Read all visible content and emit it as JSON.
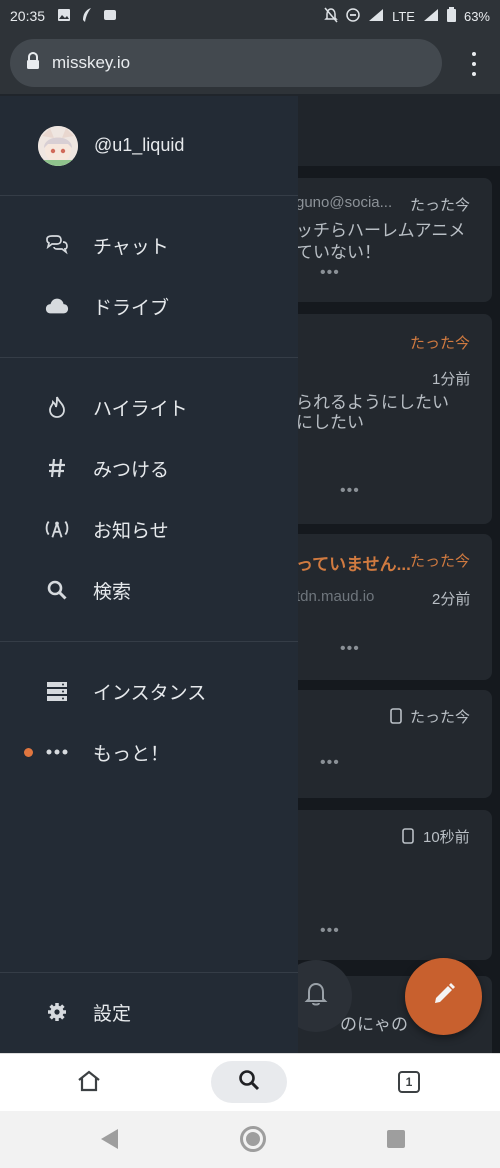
{
  "status_bar": {
    "time": "20:35",
    "network": "LTE",
    "battery": "63%",
    "icons_left": [
      "image-icon",
      "feather-icon",
      "app-icon"
    ],
    "icons_right": [
      "mute-icon",
      "dnd-icon",
      "signal-icon",
      "signal-icon",
      "battery-icon"
    ]
  },
  "browser": {
    "url": "misskey.io",
    "tab_count": "1"
  },
  "drawer": {
    "username": "@u1_liquid",
    "items": [
      {
        "label": "チャット",
        "icon": "chat-icon"
      },
      {
        "label": "ドライブ",
        "icon": "cloud-icon"
      },
      {
        "label": "ハイライト",
        "icon": "fire-icon"
      },
      {
        "label": "みつける",
        "icon": "hashtag-icon"
      },
      {
        "label": "お知らせ",
        "icon": "broadcast-icon"
      },
      {
        "label": "検索",
        "icon": "search-icon"
      },
      {
        "label": "インスタンス",
        "icon": "server-icon"
      },
      {
        "label": "もっと！",
        "icon": "more-icon"
      },
      {
        "label": "設定",
        "icon": "gear-icon"
      }
    ]
  },
  "timeline": {
    "card1": {
      "handle": "guno@socia...",
      "time": "たった今",
      "text1": "ッチらハーレムアニメ",
      "text2": "ていない！"
    },
    "card2": {
      "time": "たった今",
      "time2": "1分前",
      "text1": "られるようにしたい",
      "text2": "にしたい"
    },
    "card3": {
      "title": "っていません...",
      "time": "たった今",
      "host": "tdn.maud.io",
      "time2": "2分前"
    },
    "card4": {
      "time": "たった今"
    },
    "card5": {
      "time": "10秒前"
    },
    "card6": {
      "text": "のにゃの"
    }
  },
  "colors": {
    "accent": "#d07a40",
    "fab": "#c8602e",
    "drawer_bg": "#232b35",
    "indicator": "#e0763f"
  }
}
